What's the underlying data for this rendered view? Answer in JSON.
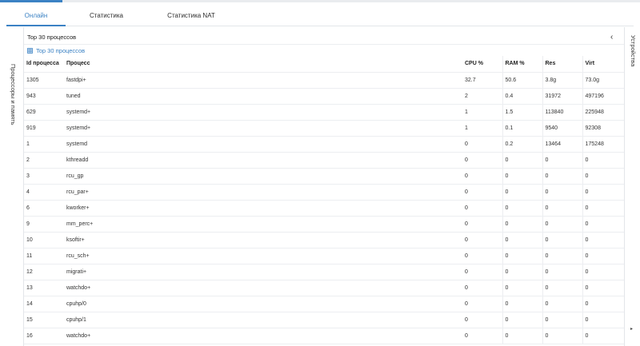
{
  "tabs": [
    {
      "label": "Онлайн",
      "active": true
    },
    {
      "label": "Статистика",
      "active": false
    },
    {
      "label": "Статистика NAT",
      "active": false
    }
  ],
  "left_rail": {
    "label": "Процессоры и память",
    "arrow": "▸"
  },
  "right_rail": {
    "label": "Устройства",
    "arrow": "▸"
  },
  "panel": {
    "title": "Top 30 процессов",
    "subtitle": "Top 30 процессов",
    "collapse_glyph": "‹"
  },
  "table": {
    "headers": {
      "id": "Id процесса",
      "process": "Процесс",
      "cpu": "CPU %",
      "ram": "RAM %",
      "res": "Res",
      "virt": "Virt"
    },
    "rows": [
      {
        "id": "1305",
        "process": "fastdpi+",
        "cpu": "32.7",
        "ram": "50.6",
        "res": "3.8g",
        "virt": "73.0g"
      },
      {
        "id": "943",
        "process": "tuned",
        "cpu": "2",
        "ram": "0.4",
        "res": "31972",
        "virt": "497196"
      },
      {
        "id": "629",
        "process": "systemd+",
        "cpu": "1",
        "ram": "1.5",
        "res": "113840",
        "virt": "225948"
      },
      {
        "id": "919",
        "process": "systemd+",
        "cpu": "1",
        "ram": "0.1",
        "res": "9540",
        "virt": "92308"
      },
      {
        "id": "1",
        "process": "systemd",
        "cpu": "0",
        "ram": "0.2",
        "res": "13464",
        "virt": "175248"
      },
      {
        "id": "2",
        "process": "kthreadd",
        "cpu": "0",
        "ram": "0",
        "res": "0",
        "virt": "0"
      },
      {
        "id": "3",
        "process": "rcu_gp",
        "cpu": "0",
        "ram": "0",
        "res": "0",
        "virt": "0"
      },
      {
        "id": "4",
        "process": "rcu_par+",
        "cpu": "0",
        "ram": "0",
        "res": "0",
        "virt": "0"
      },
      {
        "id": "6",
        "process": "kworker+",
        "cpu": "0",
        "ram": "0",
        "res": "0",
        "virt": "0"
      },
      {
        "id": "9",
        "process": "mm_perc+",
        "cpu": "0",
        "ram": "0",
        "res": "0",
        "virt": "0"
      },
      {
        "id": "10",
        "process": "ksoftir+",
        "cpu": "0",
        "ram": "0",
        "res": "0",
        "virt": "0"
      },
      {
        "id": "11",
        "process": "rcu_sch+",
        "cpu": "0",
        "ram": "0",
        "res": "0",
        "virt": "0"
      },
      {
        "id": "12",
        "process": "migrati+",
        "cpu": "0",
        "ram": "0",
        "res": "0",
        "virt": "0"
      },
      {
        "id": "13",
        "process": "watchdo+",
        "cpu": "0",
        "ram": "0",
        "res": "0",
        "virt": "0"
      },
      {
        "id": "14",
        "process": "cpuhp/0",
        "cpu": "0",
        "ram": "0",
        "res": "0",
        "virt": "0"
      },
      {
        "id": "15",
        "process": "cpuhp/1",
        "cpu": "0",
        "ram": "0",
        "res": "0",
        "virt": "0"
      },
      {
        "id": "16",
        "process": "watchdo+",
        "cpu": "0",
        "ram": "0",
        "res": "0",
        "virt": "0"
      }
    ]
  },
  "colors": {
    "accent": "#3b82c4",
    "border": "#eceef1"
  }
}
